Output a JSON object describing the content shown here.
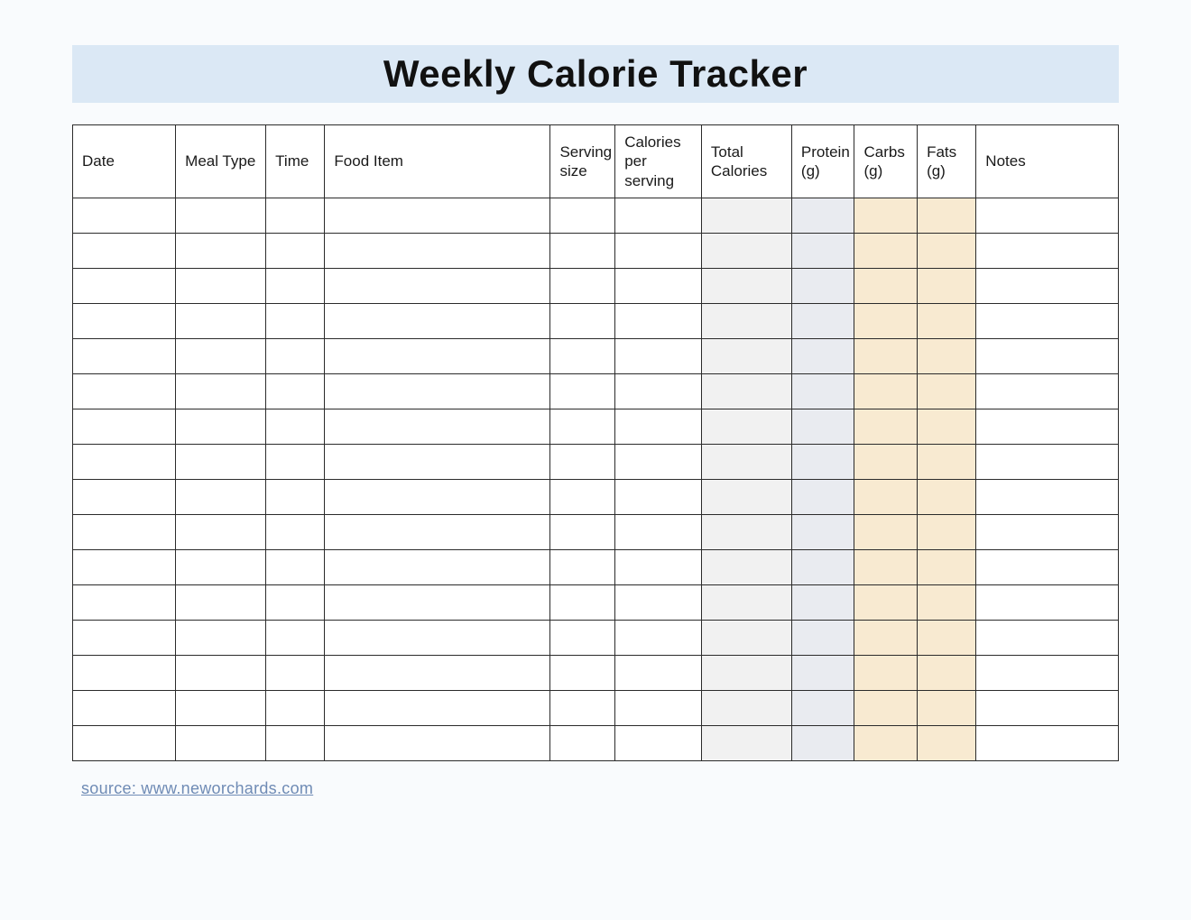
{
  "title": "Weekly Calorie Tracker",
  "columns": {
    "date": "Date",
    "meal_type": "Meal Type",
    "time": "Time",
    "food_item": "Food Item",
    "serving_size": "Serving size",
    "calories_per_serving": "Calories per serving",
    "total_calories": "Total Calories",
    "protein": "Protein (g)",
    "carbs": "Carbs (g)",
    "fats": "Fats (g)",
    "notes": "Notes"
  },
  "row_count": 16,
  "column_shading": {
    "total_calories": "#f1f1f1",
    "protein": "#e9ebf0",
    "carbs": "#f8ead1",
    "fats": "#f8ead1"
  },
  "source": {
    "label": "source: www.neworchards.com"
  }
}
